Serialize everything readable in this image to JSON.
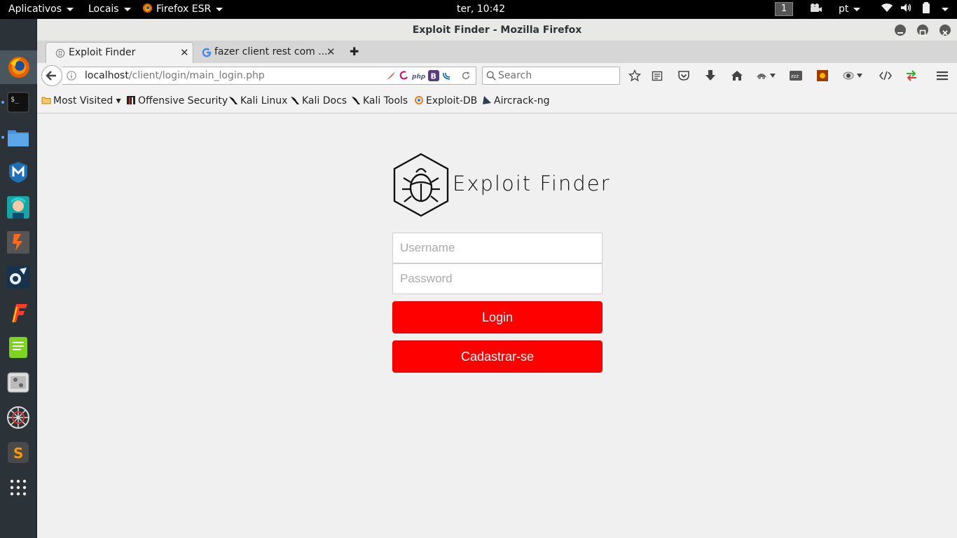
{
  "topbar": {
    "apps_label": "Aplicativos",
    "places_label": "Locais",
    "app_label": "Firefox ESR",
    "clock": "ter, 10:42",
    "workspace": "1",
    "language": "pt"
  },
  "dock": {
    "items": [
      "firefox-icon",
      "terminal-icon",
      "files-icon",
      "metasploit-icon",
      "armitage-icon",
      "burpsuite-icon",
      "maltego-icon",
      "faraday-icon",
      "leafpad-icon",
      "settings-icon",
      "spiderweb-icon",
      "sublime-icon",
      "app-grid-icon"
    ]
  },
  "window": {
    "title": "Exploit Finder - Mozilla Firefox"
  },
  "tabs": [
    {
      "title": "Exploit Finder",
      "active": true
    },
    {
      "title": "fazer client rest com ...",
      "active": false
    }
  ],
  "navbar": {
    "url_host": "localhost",
    "url_path": "/client/login/main_login.php",
    "search_placeholder": "Search"
  },
  "bookmarks": [
    {
      "label": "Most Visited ▾"
    },
    {
      "label": "Offensive Security"
    },
    {
      "label": "Kali Linux"
    },
    {
      "label": "Kali Docs"
    },
    {
      "label": "Kali Tools"
    },
    {
      "label": "Exploit-DB"
    },
    {
      "label": "Aircrack-ng"
    }
  ],
  "page": {
    "logo_text": "Exploit Finder",
    "username_placeholder": "Username",
    "password_placeholder": "Password",
    "login_label": "Login",
    "register_label": "Cadastrar-se",
    "accent_color": "#ff0000"
  }
}
